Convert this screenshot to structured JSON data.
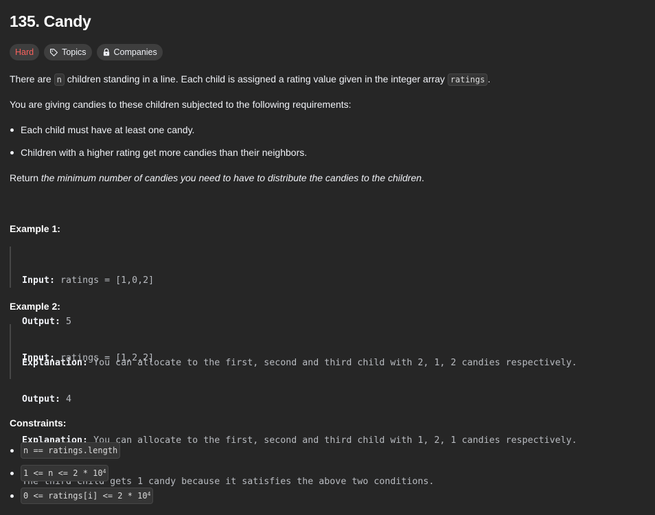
{
  "problem": {
    "title": "135. Candy",
    "difficulty": "Hard",
    "topics_label": "Topics",
    "companies_label": "Companies"
  },
  "description": {
    "p1_a": "There are ",
    "p1_code_n": "n",
    "p1_b": " children standing in a line. Each child is assigned a rating value given in the integer array ",
    "p1_code_ratings": "ratings",
    "p1_c": ".",
    "p2": "You are giving candies to these children subjected to the following requirements:",
    "requirements": [
      "Each child must have at least one candy.",
      "Children with a higher rating get more candies than their neighbors."
    ],
    "p3_a": "Return ",
    "p3_em": "the minimum number of candies you need to have to distribute the candies to the children",
    "p3_b": "."
  },
  "examples": [
    {
      "heading": "Example 1:",
      "input_label": "Input:",
      "input": " ratings = [1,0,2]",
      "output_label": "Output:",
      "output": " 5",
      "explanation_label": "Explanation:",
      "explanation": " You can allocate to the first, second and third child with 2, 1, 2 candies respectively.",
      "explanation2": ""
    },
    {
      "heading": "Example 2:",
      "input_label": "Input:",
      "input": " ratings = [1,2,2]",
      "output_label": "Output:",
      "output": " 4",
      "explanation_label": "Explanation:",
      "explanation": " You can allocate to the first, second and third child with 1, 2, 1 candies respectively.",
      "explanation2": "The third child gets 1 candy because it satisfies the above two conditions."
    }
  ],
  "constraints": {
    "heading": "Constraints:",
    "items": [
      {
        "text": "n == ratings.length",
        "sup": ""
      },
      {
        "text": "1 <= n <= 2 * 10",
        "sup": "4"
      },
      {
        "text": "0 <= ratings[i] <= 2 * 10",
        "sup": "4"
      }
    ]
  },
  "colors": {
    "background": "#262626",
    "hard": "#f8615c",
    "chip_bg": "#3e3e3e"
  },
  "icons": {
    "topics": "tag-icon",
    "companies": "lock-icon"
  }
}
